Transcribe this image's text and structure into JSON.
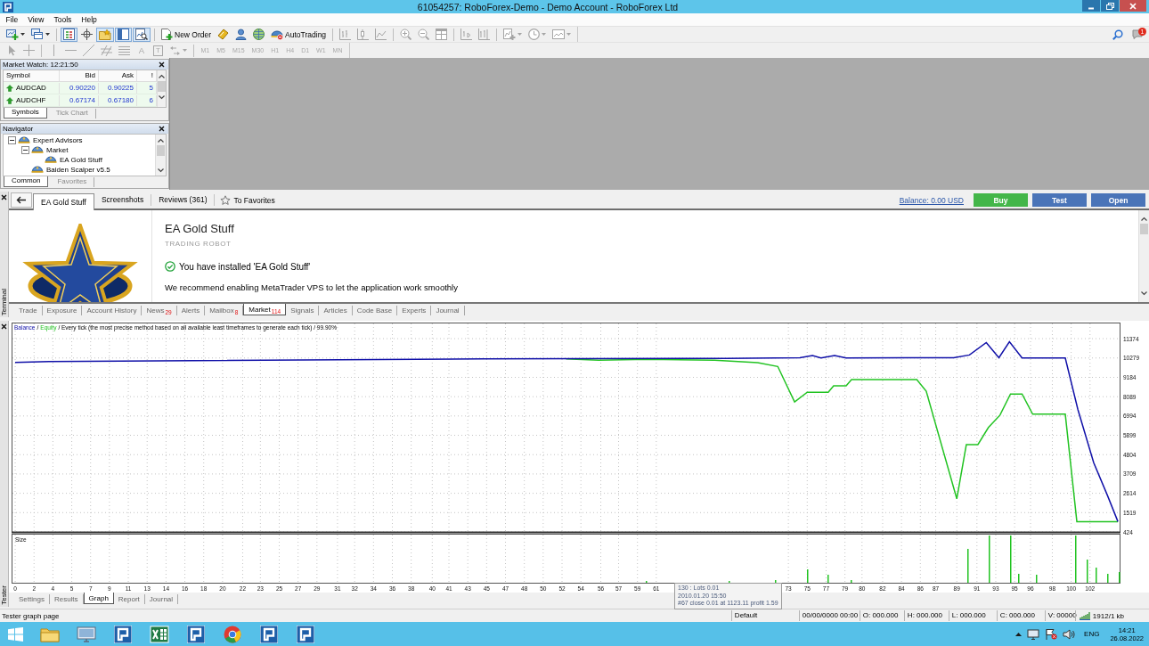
{
  "window": {
    "title": "61054257: RoboForex-Demo - Demo Account - RoboForex Ltd"
  },
  "menu": [
    "File",
    "View",
    "Tools",
    "Help"
  ],
  "toolbar": {
    "toggles": [
      {
        "on": true
      },
      {
        "on": false
      },
      {
        "on": true
      },
      {
        "on": true
      },
      {
        "on": true
      }
    ],
    "new_order": "New Order",
    "autotrading": "AutoTrading",
    "chart_tools": {
      "disabled": true
    },
    "notifications": "1"
  },
  "drawing_toolbar": {
    "disabled": true,
    "text_tool": "A",
    "label_tool": "T",
    "timeframes": [
      "M1",
      "M5",
      "M15",
      "M30",
      "H1",
      "H4",
      "D1",
      "W1",
      "MN"
    ]
  },
  "market_watch": {
    "title": "Market Watch: 12:21:50",
    "columns": [
      "Symbol",
      "Bid",
      "Ask",
      "!"
    ],
    "rows": [
      [
        "AUDCAD",
        "0.90220",
        "0.90225",
        "5"
      ],
      [
        "AUDCHF",
        "0.67174",
        "0.67180",
        "6"
      ]
    ],
    "tabs": [
      {
        "label": "Symbols",
        "selected": true
      },
      {
        "label": "Tick Chart",
        "selected": false
      }
    ]
  },
  "navigator": {
    "title": "Navigator",
    "tree": [
      {
        "label": "Expert Advisors",
        "expanded": true,
        "children": [
          {
            "label": "Market",
            "expanded": true,
            "children": [
              {
                "label": "EA Gold Stuff"
              }
            ]
          },
          {
            "label": "Baiden Scalper v5.5"
          }
        ]
      }
    ],
    "tabs": [
      {
        "label": "Common",
        "selected": true
      },
      {
        "label": "Favorites",
        "selected": false
      }
    ]
  },
  "terminal": {
    "label": "Terminal",
    "tabs": [
      {
        "label": "EA Gold Stuff",
        "selected": true
      },
      {
        "label": "Screenshots",
        "selected": false
      },
      {
        "label": "Reviews (361)",
        "selected": false
      }
    ],
    "favorites": "To Favorites",
    "balance": "Balance: 0.00 USD",
    "actions": [
      {
        "label": "Buy",
        "color": "#43b649"
      },
      {
        "label": "Test",
        "color": "#4a74b8"
      },
      {
        "label": "Open",
        "color": "#4a74b8"
      }
    ],
    "product": {
      "name": "EA Gold Stuff",
      "category": "TRADING ROBOT",
      "notice": "You have installed 'EA Gold Stuff'",
      "recommendation": "We recommend enabling MetaTrader VPS to let the application work smoothly"
    },
    "panel_tabs": [
      {
        "label": "Trade",
        "selected": false
      },
      {
        "label": "Exposure",
        "selected": false
      },
      {
        "label": "Account History",
        "selected": false
      },
      {
        "label": "News",
        "badge": "29",
        "selected": false
      },
      {
        "label": "Alerts",
        "selected": false
      },
      {
        "label": "Mailbox",
        "badge": "8",
        "selected": false
      },
      {
        "label": "Market",
        "badge": "114",
        "selected": true
      },
      {
        "label": "Signals",
        "selected": false
      },
      {
        "label": "Articles",
        "selected": false
      },
      {
        "label": "Code Base",
        "selected": false
      },
      {
        "label": "Experts",
        "selected": false
      },
      {
        "label": "Journal",
        "selected": false
      }
    ]
  },
  "tester": {
    "label": "Tester",
    "legend_separator": "/",
    "chart_data": [
      {
        "type": "line",
        "subtitle": "/ Every tick (the most precise method based on all available least timeframes to generate each tick) / 99.90%",
        "series": [
          {
            "name": "Balance",
            "color": "#1010a8",
            "axis": "y2",
            "x": [
              0,
              3.2,
              44.6,
              67.5,
              74.5,
              75.7,
              76.5,
              77.8,
              78.9,
              89.1,
              90.6,
              92.2,
              93.4,
              94.4,
              95.6,
              99.7,
              100.9,
              102.4,
              103.7,
              104.7
            ],
            "values": [
              10030,
              10080,
              10230,
              10260,
              10300,
              10420,
              10280,
              10420,
              10280,
              10300,
              10450,
              11150,
              10300,
              11200,
              10280,
              10280,
              7350,
              4350,
              2500,
              1010
            ]
          },
          {
            "name": "Equity",
            "color": "#22c322",
            "axis": "y2",
            "x": [
              52.3,
              55.4,
              60,
              66.4,
              70.5,
              72.4,
              74,
              75.2,
              77.2,
              77.7,
              78.9,
              79.4,
              85.6,
              86.5,
              89.4,
              90.3,
              91.4,
              92.4,
              93.5,
              94.5,
              95.6,
              96.6,
              99.7,
              100.8,
              104.7
            ],
            "values": [
              10230,
              10150,
              10200,
              10150,
              10020,
              9800,
              7790,
              8340,
              8340,
              8700,
              8700,
              9050,
              9050,
              8400,
              2300,
              5370,
              5370,
              6340,
              7040,
              8240,
              8240,
              7100,
              7100,
              1010,
              1010
            ]
          }
        ],
        "xlim": [
          -0.3,
          104.9
        ],
        "y2lim": [
          424,
          12287
        ],
        "y2ticks": [
          424,
          1519,
          2614,
          3709,
          4804,
          5899,
          6994,
          8089,
          9184,
          10279,
          11374
        ],
        "xticks": [
          {
            "value": 0,
            "label": "0"
          },
          {
            "value": 1.79,
            "label": "2"
          },
          {
            "value": 3.58,
            "label": "4"
          },
          {
            "value": 5.37,
            "label": "5"
          },
          {
            "value": 7.16,
            "label": "7"
          },
          {
            "value": 8.95,
            "label": "9"
          },
          {
            "value": 10.74,
            "label": "11"
          },
          {
            "value": 12.53,
            "label": "13"
          },
          {
            "value": 14.32,
            "label": "14"
          },
          {
            "value": 16.11,
            "label": "16"
          },
          {
            "value": 17.9,
            "label": "18"
          },
          {
            "value": 19.69,
            "label": "20"
          },
          {
            "value": 21.6,
            "label": "22"
          },
          {
            "value": 23.28,
            "label": "23"
          },
          {
            "value": 25.07,
            "label": "25"
          },
          {
            "value": 26.86,
            "label": "27"
          },
          {
            "value": 28.65,
            "label": "29"
          },
          {
            "value": 30.6,
            "label": "31"
          },
          {
            "value": 32.23,
            "label": "32"
          },
          {
            "value": 34.02,
            "label": "34"
          },
          {
            "value": 35.81,
            "label": "36"
          },
          {
            "value": 37.6,
            "label": "38"
          },
          {
            "value": 39.6,
            "label": "40"
          },
          {
            "value": 41.18,
            "label": "41"
          },
          {
            "value": 42.97,
            "label": "43"
          },
          {
            "value": 44.76,
            "label": "45"
          },
          {
            "value": 46.55,
            "label": "47"
          },
          {
            "value": 48.34,
            "label": "48"
          },
          {
            "value": 50.13,
            "label": "50"
          },
          {
            "value": 51.92,
            "label": "52"
          },
          {
            "value": 53.71,
            "label": "54"
          },
          {
            "value": 55.6,
            "label": "56"
          },
          {
            "value": 57.29,
            "label": "57"
          },
          {
            "value": 59.08,
            "label": "59"
          },
          {
            "value": 60.87,
            "label": "61"
          },
          {
            "value": 73.41,
            "label": "73"
          },
          {
            "value": 75.2,
            "label": "75"
          },
          {
            "value": 76.99,
            "label": "77"
          },
          {
            "value": 78.78,
            "label": "79"
          },
          {
            "value": 80.4,
            "label": "80"
          },
          {
            "value": 82.36,
            "label": "82"
          },
          {
            "value": 84.15,
            "label": "84"
          },
          {
            "value": 85.94,
            "label": "86"
          },
          {
            "value": 87.4,
            "label": "87"
          },
          {
            "value": 89.4,
            "label": "89"
          },
          {
            "value": 91.31,
            "label": "91"
          },
          {
            "value": 93.1,
            "label": "93"
          },
          {
            "value": 94.89,
            "label": "95"
          },
          {
            "value": 96.4,
            "label": "96"
          },
          {
            "value": 98.47,
            "label": "98"
          },
          {
            "value": 100.26,
            "label": "100"
          },
          {
            "value": 102.05,
            "label": "102"
          }
        ],
        "grid": true
      }
    ],
    "size_label": "Size",
    "tooltip": [
      "130 : Lots 0.01",
      "2010.01.20 15:50",
      "#67 close 0.01 at 1123.11 profit 1.59"
    ],
    "tabs": [
      {
        "label": "Settings",
        "selected": false
      },
      {
        "label": "Results",
        "selected": false
      },
      {
        "label": "Graph",
        "selected": true
      },
      {
        "label": "Report",
        "selected": false
      },
      {
        "label": "Journal",
        "selected": false
      }
    ]
  },
  "status_bar": {
    "text": "Tester graph page",
    "fields": [
      "Default",
      "00/00/0000 00:00",
      "O: 000.000",
      "H: 000.000",
      "L: 000.000",
      "C: 000.000",
      "V: 00000"
    ],
    "traffic": "1912/1 kb"
  },
  "taskbar": {
    "language": "ENG",
    "time": "14:21",
    "date": "26.08.2022"
  }
}
